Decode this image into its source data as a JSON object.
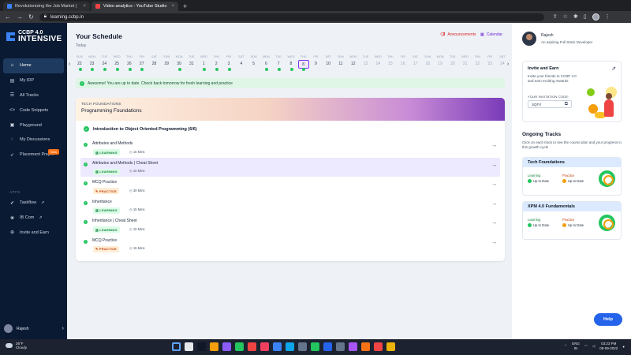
{
  "browser": {
    "tabs": [
      {
        "title": "Revolutionizing the Job Market |",
        "favicon_color": "#3b82f6",
        "active": false
      },
      {
        "title": "Video analytics - YouTube Studio",
        "favicon_color": "#ef4444",
        "active": true
      }
    ],
    "url": "learning.ccbp.in"
  },
  "sidebar": {
    "logo_top": "CCBP 4.0",
    "logo_bottom": "INTENSIVE",
    "items": [
      {
        "label": "Home",
        "icon": "home-icon",
        "glyph": "⌂"
      },
      {
        "label": "My IDP",
        "icon": "idp-icon",
        "glyph": "▤"
      },
      {
        "label": "All Tracks",
        "icon": "tracks-icon",
        "glyph": "☰"
      },
      {
        "label": "Code Snippets",
        "icon": "code-icon",
        "glyph": "<>"
      },
      {
        "label": "Playground",
        "icon": "playground-icon",
        "glyph": "▣"
      },
      {
        "label": "My Discussions",
        "icon": "discussion-icon",
        "glyph": "◌"
      },
      {
        "label": "Placement Prep...",
        "icon": "rocket-icon",
        "glyph": "➶"
      }
    ],
    "new_badge": "New",
    "apps_label": "APPS",
    "apps": [
      {
        "label": "Taskflow",
        "icon": "taskflow-icon",
        "glyph": "✔"
      },
      {
        "label": "IB Com",
        "icon": "ibcom-icon",
        "glyph": "❀"
      },
      {
        "label": "Invite and Earn",
        "icon": "invite-icon",
        "glyph": "⊕"
      }
    ],
    "user": "Rajesh"
  },
  "schedule": {
    "title": "Your Schedule",
    "today_label": "Today",
    "announcements": "Announcements",
    "calendar": "Calendar",
    "days": [
      {
        "n": "SUN",
        "d": "22",
        "done": true
      },
      {
        "n": "MON",
        "d": "23",
        "done": true
      },
      {
        "n": "TUE",
        "d": "24",
        "done": true
      },
      {
        "n": "WED",
        "d": "25",
        "done": true
      },
      {
        "n": "THU",
        "d": "26",
        "done": true
      },
      {
        "n": "FRI",
        "d": "27",
        "done": true
      },
      {
        "n": "SAT",
        "d": "28",
        "done": false
      },
      {
        "n": "SUN",
        "d": "29",
        "done": false
      },
      {
        "n": "MON",
        "d": "30",
        "done": true
      },
      {
        "n": "TUE",
        "d": "31",
        "done": false
      },
      {
        "n": "WED",
        "d": "1",
        "done": true
      },
      {
        "n": "THU",
        "d": "2",
        "done": true
      },
      {
        "n": "FRI",
        "d": "3",
        "done": true
      },
      {
        "n": "SAT",
        "d": "4",
        "done": false
      },
      {
        "n": "SUN",
        "d": "5",
        "done": false
      },
      {
        "n": "MON",
        "d": "6",
        "done": true
      },
      {
        "n": "TUE",
        "d": "7",
        "done": true
      },
      {
        "n": "WED",
        "d": "8",
        "done": true
      },
      {
        "n": "THU",
        "d": "8",
        "done": true,
        "today": true
      },
      {
        "n": "FRI",
        "d": "9",
        "done": false
      },
      {
        "n": "SAT",
        "d": "10",
        "done": false
      },
      {
        "n": "SUN",
        "d": "11",
        "done": false
      },
      {
        "n": "MON",
        "d": "12",
        "done": false
      },
      {
        "n": "TUE",
        "d": "13",
        "done": false,
        "future": true
      },
      {
        "n": "WED",
        "d": "14",
        "done": false,
        "future": true
      },
      {
        "n": "THU",
        "d": "15",
        "done": false,
        "future": true
      },
      {
        "n": "FRI",
        "d": "16",
        "done": false,
        "future": true
      },
      {
        "n": "SAT",
        "d": "17",
        "done": false,
        "future": true
      },
      {
        "n": "SUN",
        "d": "18",
        "done": false,
        "future": true
      },
      {
        "n": "MON",
        "d": "19",
        "done": false,
        "future": true
      },
      {
        "n": "TUE",
        "d": "20",
        "done": false,
        "future": true
      },
      {
        "n": "WED",
        "d": "21",
        "done": false,
        "future": true
      },
      {
        "n": "THU",
        "d": "22",
        "done": false,
        "future": true
      },
      {
        "n": "FRI",
        "d": "23",
        "done": false,
        "future": true
      },
      {
        "n": "SAT",
        "d": "24",
        "done": false,
        "future": true
      }
    ],
    "success_msg": "Awesome! You are up to date. Check back tomorrow for fresh learning and practice"
  },
  "course": {
    "tag": "TECH FOUNDATIONS",
    "name": "Programming Foundations",
    "topic": "Introduction to Object Oriented Programming (6/6)",
    "items": [
      {
        "name": "Attributes and Methods",
        "type": "LEARNING",
        "duration": "15 Mins",
        "highlight": false
      },
      {
        "name": "Attributes and Methods | Cheat Sheet",
        "type": "LEARNING",
        "duration": "10 Mins",
        "highlight": true
      },
      {
        "name": "MCQ Practice",
        "type": "PRACTICE",
        "duration": "30 Mins",
        "highlight": false
      },
      {
        "name": "Inheritance",
        "type": "LEARNING",
        "duration": "15 Mins",
        "highlight": false
      },
      {
        "name": "Inheritance | Cheat Sheet",
        "type": "LEARNING",
        "duration": "10 Mins",
        "highlight": false
      },
      {
        "name": "MCQ Practice",
        "type": "PRACTICE",
        "duration": "15 Mins",
        "highlight": false
      }
    ]
  },
  "right": {
    "name": "Rajesh",
    "tagline": "An aspiring Full Stack Developer",
    "invite_title": "Invite and Earn",
    "invite_desc": "Invite your friends to CCBP 4.0 and earn exciting rewards",
    "code_label": "YOUR INVITATION CODE:",
    "code": "SQFX",
    "ongoing_title": "Ongoing Tracks",
    "ongoing_desc": "Click on each track to see the course plan and your progress in this growth cycle",
    "tracks": [
      {
        "name": "Tech Foundations",
        "learning_label": "Learning",
        "learning_status": "Up to Date",
        "practice_label": "Practice",
        "practice_status": "Up to Date"
      },
      {
        "name": "XPM 4.0 Fundamentals",
        "learning_label": "Learning",
        "learning_status": "Up to Date",
        "practice_label": "Practice",
        "practice_status": "Up to Date"
      }
    ],
    "help": "Help"
  },
  "taskbar": {
    "temp": "26°F",
    "weather": "Cloudy",
    "lang1": "ENG",
    "lang2": "IN",
    "time": "03:23 PM",
    "date": "08-09-2022",
    "icon_colors": [
      "#60a5fa",
      "#e5e7eb",
      "#111827",
      "#f59e0b",
      "#8b5cf6",
      "#22c55e",
      "#ef4444",
      "#f43f5e",
      "#3b82f6",
      "#0ea5e9",
      "#64748b",
      "#22c55e",
      "#2563eb",
      "#64748b",
      "#a855f7",
      "#f97316",
      "#ef4444",
      "#eab308"
    ]
  },
  "colors": {
    "accent": "#3b82f6",
    "sidebar_bg": "#0b1a33",
    "success": "#22c55e",
    "practice": "#c2410c"
  }
}
